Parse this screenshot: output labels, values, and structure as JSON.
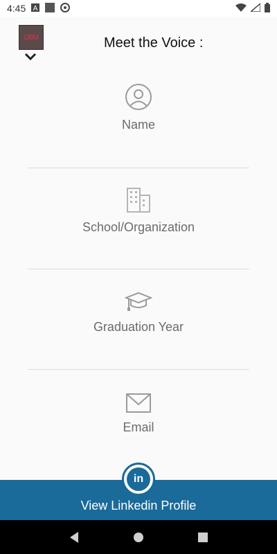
{
  "status_bar": {
    "time": "4:45",
    "icons": [
      "font-a-icon",
      "square-icon",
      "at-sign-icon",
      "wifi-icon",
      "no-signal-icon",
      "battery-icon"
    ]
  },
  "header": {
    "logo_text": "DBM",
    "title": "Meet the Voice :"
  },
  "sections": [
    {
      "label": "Name",
      "icon": "person-icon"
    },
    {
      "label": "School/Organization",
      "icon": "building-icon"
    },
    {
      "label": "Graduation Year",
      "icon": "graduation-cap-icon"
    },
    {
      "label": "Email",
      "icon": "envelope-icon"
    }
  ],
  "linkedin": {
    "button_label": "View Linkedin Profile",
    "icon_text": "in"
  },
  "nav": {
    "icons": [
      "back-icon",
      "home-icon",
      "recents-icon"
    ]
  },
  "colors": {
    "accent": "#1a6a9a",
    "background": "#fafafa",
    "label": "#6b6b6b"
  }
}
